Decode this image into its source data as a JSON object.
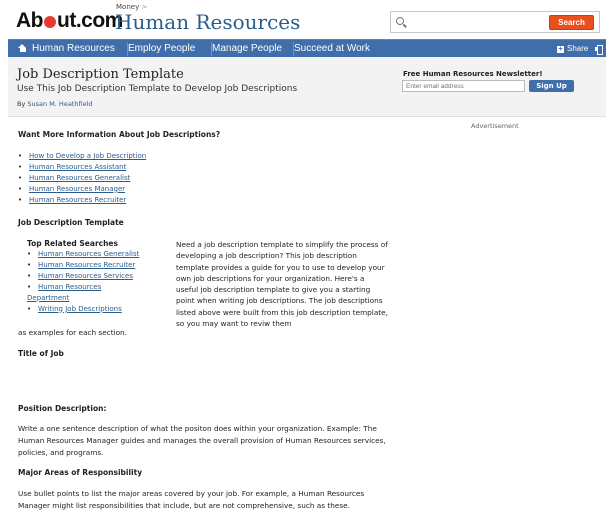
{
  "header": {
    "brand_about": "Ab",
    "brand_out": "ut.com",
    "money_label": "Money",
    "money_arrow": ">",
    "site_title": "Human Resources",
    "search_placeholder": "",
    "search_button": "Search"
  },
  "nav": {
    "items": [
      {
        "label": "Human Resources"
      },
      {
        "label": "Employ People"
      },
      {
        "label": "Manage People"
      },
      {
        "label": "Succeed at Work"
      }
    ],
    "share": "Share"
  },
  "title_area": {
    "title": "Job Description Template",
    "subtitle": "Use This Job Description Template to Develop Job Descriptions",
    "byline_prefix": "By",
    "author": "Susan M. Heathfield"
  },
  "newsletter": {
    "title": "Free Human Resources Newsletter!",
    "placeholder": "Enter email address",
    "button": "Sign Up"
  },
  "advertisement": "Advertisement",
  "content": {
    "more_info_heading": "Want More Information About Job Descriptions?",
    "more_info_links": [
      "How to Develop a Job Description",
      "Human Resources Assistant",
      "Human Resources Generalist",
      "Human Resources Manager",
      "Human Resources Recruiter"
    ],
    "template_heading": "Job Description Template",
    "related_title": "Top Related Searches",
    "related_links": [
      "Human Resources Generalist",
      "Human Resources Recruiter",
      "Human Resources Services",
      "Human Resources Department",
      "Writing Job Descriptions"
    ],
    "intro": "Need a job description template to simplify the process of developing a job description? This job description template provides a guide for you to use to develop your own job descriptions for your organization. Here's a useful job description template to give you a starting point when writing job descriptions. The job descriptions listed above were built from this job description template, so you may want to reviw them",
    "intro_tail": "as examples for each section.",
    "title_of_job_heading": "Title of Job",
    "position_heading": "Position Description:",
    "position_text": "Write a one sentence description of what the positon does within your organization. Example: The Human Resources Manager guides and manages the overall provision of Human Resources services, policies, and programs.",
    "major_heading": "Major Areas of Responsibility",
    "major_text": "Use bullet points to list the major areas covered by your job. For example, a Human Resources Manager might list responsibilities that include, but are not comprehensive, such as these."
  }
}
